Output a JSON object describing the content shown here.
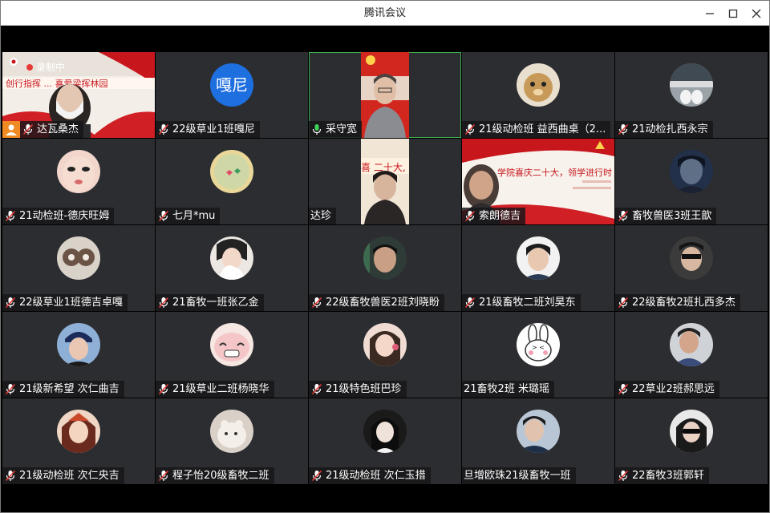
{
  "window": {
    "title": "腾讯会议"
  },
  "recording": {
    "label": "录制中"
  },
  "colors": {
    "accent": "#1e6fe0",
    "speaking": "#3fae4e",
    "host": "#f08a22",
    "muted": "#e53935"
  },
  "participants": [
    {
      "name": "达瓦桑杰",
      "mic": "muted",
      "view": "video",
      "role": "host"
    },
    {
      "name": "22级草业1班嘎尼",
      "mic": "muted",
      "view": "text-avatar",
      "avatar_text": "嘎尼"
    },
    {
      "name": "采守宽",
      "mic": "active",
      "view": "video",
      "speaking": true
    },
    {
      "name": "21级动检班 益西曲桌（2...",
      "mic": "muted",
      "view": "avatar"
    },
    {
      "name": "21动检扎西永宗",
      "mic": "muted",
      "view": "avatar"
    },
    {
      "name": "21动检班-德庆旺姆",
      "mic": "muted",
      "view": "avatar"
    },
    {
      "name": "七月*mu",
      "mic": "muted",
      "view": "avatar"
    },
    {
      "name": "达珍",
      "mic": "none",
      "view": "video"
    },
    {
      "name": "索朗德吉",
      "mic": "muted",
      "view": "video"
    },
    {
      "name": "畜牧兽医3班王歆",
      "mic": "muted",
      "view": "avatar"
    },
    {
      "name": "22级草业1班德吉卓嘎",
      "mic": "muted",
      "view": "avatar"
    },
    {
      "name": "21畜牧一班张乙金",
      "mic": "muted",
      "view": "avatar"
    },
    {
      "name": "22级畜牧兽医2班刘晓盼",
      "mic": "muted",
      "view": "avatar"
    },
    {
      "name": "21级畜牧二班刘昊东",
      "mic": "muted",
      "view": "avatar"
    },
    {
      "name": "22级畜牧2班扎西多杰",
      "mic": "muted",
      "view": "avatar"
    },
    {
      "name": "21级新希望 次仁曲吉",
      "mic": "muted",
      "view": "avatar"
    },
    {
      "name": "21级草业二班杨晓华",
      "mic": "muted",
      "view": "avatar"
    },
    {
      "name": "21级特色班巴珍",
      "mic": "muted",
      "view": "avatar"
    },
    {
      "name": "21畜牧2班 米璐瑶",
      "mic": "none",
      "view": "avatar"
    },
    {
      "name": "22草业2班郝思远",
      "mic": "muted",
      "view": "avatar"
    },
    {
      "name": "21级动检班 次仁央吉",
      "mic": "muted",
      "view": "avatar"
    },
    {
      "name": "程子怡20级畜牧二班",
      "mic": "muted",
      "view": "avatar"
    },
    {
      "name": "21级动检班 次仁玉措",
      "mic": "muted",
      "view": "avatar"
    },
    {
      "name": "旦增欧珠21级畜牧一班",
      "mic": "none",
      "view": "avatar"
    },
    {
      "name": "22畜牧3班郭轩",
      "mic": "muted",
      "view": "avatar"
    }
  ],
  "banners": {
    "t1": "创行指挥 ... 喜爱梁挥林园",
    "t9": "学院喜庆二十大，领学进行时"
  }
}
